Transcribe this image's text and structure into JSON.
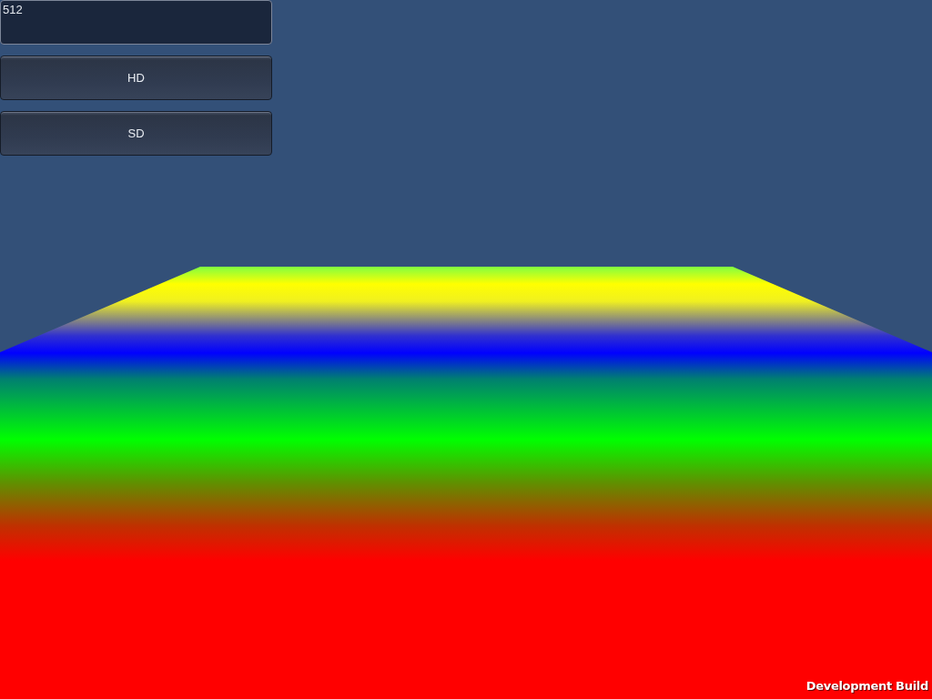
{
  "text_area": {
    "value": "512"
  },
  "buttons": [
    "HD",
    "SD"
  ],
  "overlay_label": "Development Build"
}
